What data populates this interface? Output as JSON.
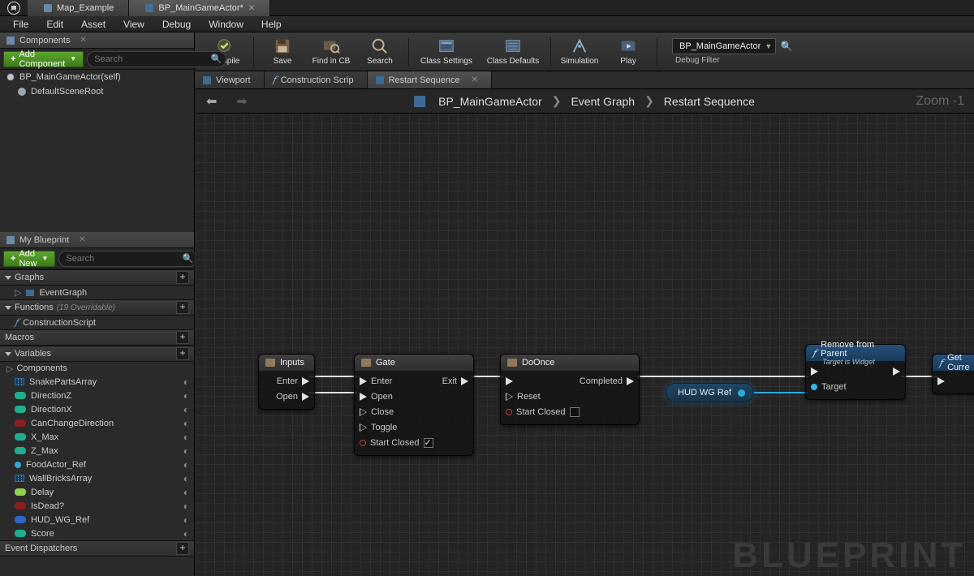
{
  "doc_tabs": [
    {
      "label": "Map_Example",
      "active": false
    },
    {
      "label": "BP_MainGameActor*",
      "active": true
    }
  ],
  "menu": [
    "File",
    "Edit",
    "Asset",
    "View",
    "Debug",
    "Window",
    "Help"
  ],
  "components_panel": {
    "title": "Components",
    "add_button": "Add Component",
    "search_placeholder": "Search",
    "items": [
      {
        "label": "BP_MainGameActor(self)"
      },
      {
        "label": "DefaultSceneRoot"
      }
    ]
  },
  "myblueprint_panel": {
    "title": "My Blueprint",
    "add_button": "Add New",
    "search_placeholder": "Search",
    "sections": {
      "graphs": {
        "title": "Graphs",
        "items": [
          "EventGraph"
        ]
      },
      "functions": {
        "title": "Functions",
        "note": "(19 Overridable)",
        "items": [
          "ConstructionScript"
        ]
      },
      "macros": {
        "title": "Macros",
        "items": []
      },
      "variables": {
        "title": "Variables",
        "subhead": "Components",
        "items": [
          {
            "name": "SnakePartsArray",
            "icon": "grid",
            "color": "#3d87c5"
          },
          {
            "name": "DirectionZ",
            "icon": "pill",
            "color": "#1fae8e"
          },
          {
            "name": "DirectionX",
            "icon": "pill",
            "color": "#1fae8e"
          },
          {
            "name": "CanChangeDirection",
            "icon": "pill",
            "color": "#8a1f1f"
          },
          {
            "name": "X_Max",
            "icon": "pill",
            "color": "#1fae8e"
          },
          {
            "name": "Z_Max",
            "icon": "pill",
            "color": "#1fae8e"
          },
          {
            "name": "FoodActor_Ref",
            "icon": "dot",
            "color": "#2fa8d8"
          },
          {
            "name": "WallBricksArray",
            "icon": "grid",
            "color": "#3d87c5"
          },
          {
            "name": "Delay",
            "icon": "pill",
            "color": "#93d04f"
          },
          {
            "name": "IsDead?",
            "icon": "pill",
            "color": "#8a1f1f"
          },
          {
            "name": "HUD_WG_Ref",
            "icon": "pill",
            "color": "#2f66c5"
          },
          {
            "name": "Score",
            "icon": "pill",
            "color": "#1fae8e"
          }
        ]
      },
      "dispatchers": {
        "title": "Event Dispatchers",
        "items": []
      }
    }
  },
  "toolbar": {
    "buttons": [
      "Compile",
      "Save",
      "Find in CB",
      "Search",
      "Class Settings",
      "Class Defaults",
      "Simulation",
      "Play"
    ],
    "combo": "BP_MainGameActor",
    "debug_filter": "Debug Filter"
  },
  "graph_tabs": [
    {
      "label": "Viewport",
      "kind": "v",
      "active": false
    },
    {
      "label": "Construction Scrip",
      "kind": "f",
      "active": false
    },
    {
      "label": "Restart Sequence",
      "kind": "g",
      "active": true
    }
  ],
  "breadcrumb": {
    "root": "BP_MainGameActor",
    "mid": "Event Graph",
    "leaf": "Restart Sequence"
  },
  "zoom": "Zoom -1",
  "nodes": {
    "inputs": {
      "title": "Inputs",
      "rows": [
        "Enter",
        "Open"
      ]
    },
    "gate": {
      "title": "Gate",
      "ins": [
        "Enter",
        "Open",
        "Close",
        "Toggle"
      ],
      "start_closed": "Start Closed",
      "out": "Exit"
    },
    "doonce": {
      "title": "DoOnce",
      "reset": "Reset",
      "start_closed": "Start Closed",
      "out": "Completed"
    },
    "remove": {
      "title": "Remove from Parent",
      "sub": "Target is Widget",
      "target": "Target"
    },
    "getcur": {
      "title": "Get Curre"
    },
    "hudref": {
      "label": "HUD WG Ref"
    }
  },
  "watermark": "BLUEPRINT"
}
